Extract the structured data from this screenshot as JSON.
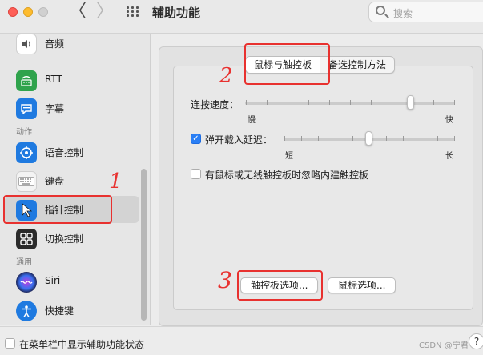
{
  "window": {
    "title": "辅助功能",
    "search_placeholder": "搜索"
  },
  "nav": {
    "back": "〈",
    "forward": "〉"
  },
  "sidebar": {
    "items": [
      {
        "label": "音频",
        "icon": "speaker-icon",
        "color": "#6b6b6b"
      },
      {
        "label": "RTT",
        "icon": "tty-icon",
        "color": "#2fa34c"
      },
      {
        "label": "字幕",
        "icon": "captions-icon",
        "color": "#1f7ae0"
      },
      {
        "label": "语音控制",
        "icon": "voice-control-icon",
        "color": "#1f7ae0"
      },
      {
        "label": "键盘",
        "icon": "keyboard-icon",
        "color": "#d9d9d9"
      },
      {
        "label": "指针控制",
        "icon": "pointer-icon",
        "color": "#1f7ae0"
      },
      {
        "label": "切换控制",
        "icon": "switch-control-icon",
        "color": "#2b2b2b"
      },
      {
        "label": "Siri",
        "icon": "siri-icon",
        "color": "#2a2a6e"
      },
      {
        "label": "快捷键",
        "icon": "accessibility-shortcut-icon",
        "color": "#1f7ae0"
      }
    ],
    "sections": [
      "动作",
      "通用"
    ],
    "selected_index": 5
  },
  "tabs": [
    {
      "label": "鼠标与触控板",
      "active": true
    },
    {
      "label": "备选控制方法",
      "active": false
    }
  ],
  "settings": {
    "double_click_speed": {
      "label": "连按速度：",
      "min_label": "慢",
      "max_label": "快",
      "value": 0.8
    },
    "spring_loading": {
      "label": "弹开载入延迟：",
      "checked": true,
      "min_label": "短",
      "max_label": "长",
      "value": 0.5
    },
    "ignore_trackpad": {
      "label": "有鼠标或无线触控板时忽略内建触控板",
      "checked": false
    }
  },
  "buttons": {
    "trackpad_options": "触控板选项...",
    "mouse_options": "鼠标选项..."
  },
  "footer": {
    "show_in_menubar": "在菜单栏中显示辅助功能状态",
    "show_in_menubar_checked": false,
    "help": "?",
    "watermark": "CSDN @宁君"
  },
  "annotations": [
    "1",
    "2",
    "3"
  ],
  "colors": {
    "accent": "#2a7ff5",
    "annotation_red": "#e8312f"
  }
}
